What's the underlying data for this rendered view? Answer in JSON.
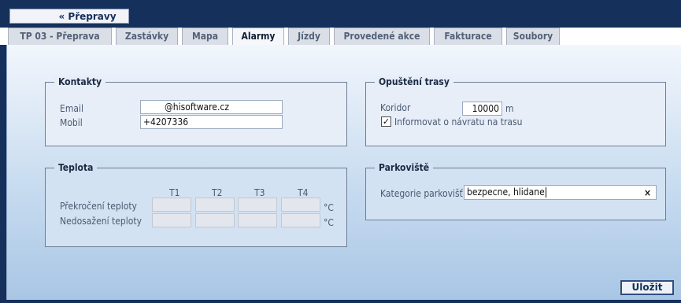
{
  "nav": {
    "back_label": "« Přepravy"
  },
  "tabs": [
    {
      "label": "TP 03 - Přeprava",
      "active": false
    },
    {
      "label": "Zastávky",
      "active": false
    },
    {
      "label": "Mapa",
      "active": false
    },
    {
      "label": "Alarmy",
      "active": true
    },
    {
      "label": "Jízdy",
      "active": false
    },
    {
      "label": "Provedené akce",
      "active": false
    },
    {
      "label": "Fakturace",
      "active": false
    },
    {
      "label": "Soubory",
      "active": false
    }
  ],
  "contacts": {
    "title": "Kontakty",
    "email_label": "Email",
    "email_value": "@hisoftware.cz",
    "mobile_label": "Mobil",
    "mobile_value": "+4207336"
  },
  "route_exit": {
    "title": "Opuštění trasy",
    "corridor_label": "Koridor",
    "corridor_value": "10000",
    "corridor_unit": "m",
    "notify_label": "Informovat o návratu na trasu",
    "notify_checked": true
  },
  "temperature": {
    "title": "Teplota",
    "columns": [
      "T1",
      "T2",
      "T3",
      "T4"
    ],
    "row_over_label": "Překročení teploty",
    "row_under_label": "Nedosažení teploty",
    "unit": "°C"
  },
  "parking": {
    "title": "Parkoviště",
    "category_label": "Kategorie parkovišť",
    "category_value": "bezpecne, hlidane",
    "clear_symbol": "×"
  },
  "actions": {
    "save_label": "Uložit"
  },
  "colors": {
    "dark_navy": "#14305b",
    "accent": "#2f4e7e"
  }
}
